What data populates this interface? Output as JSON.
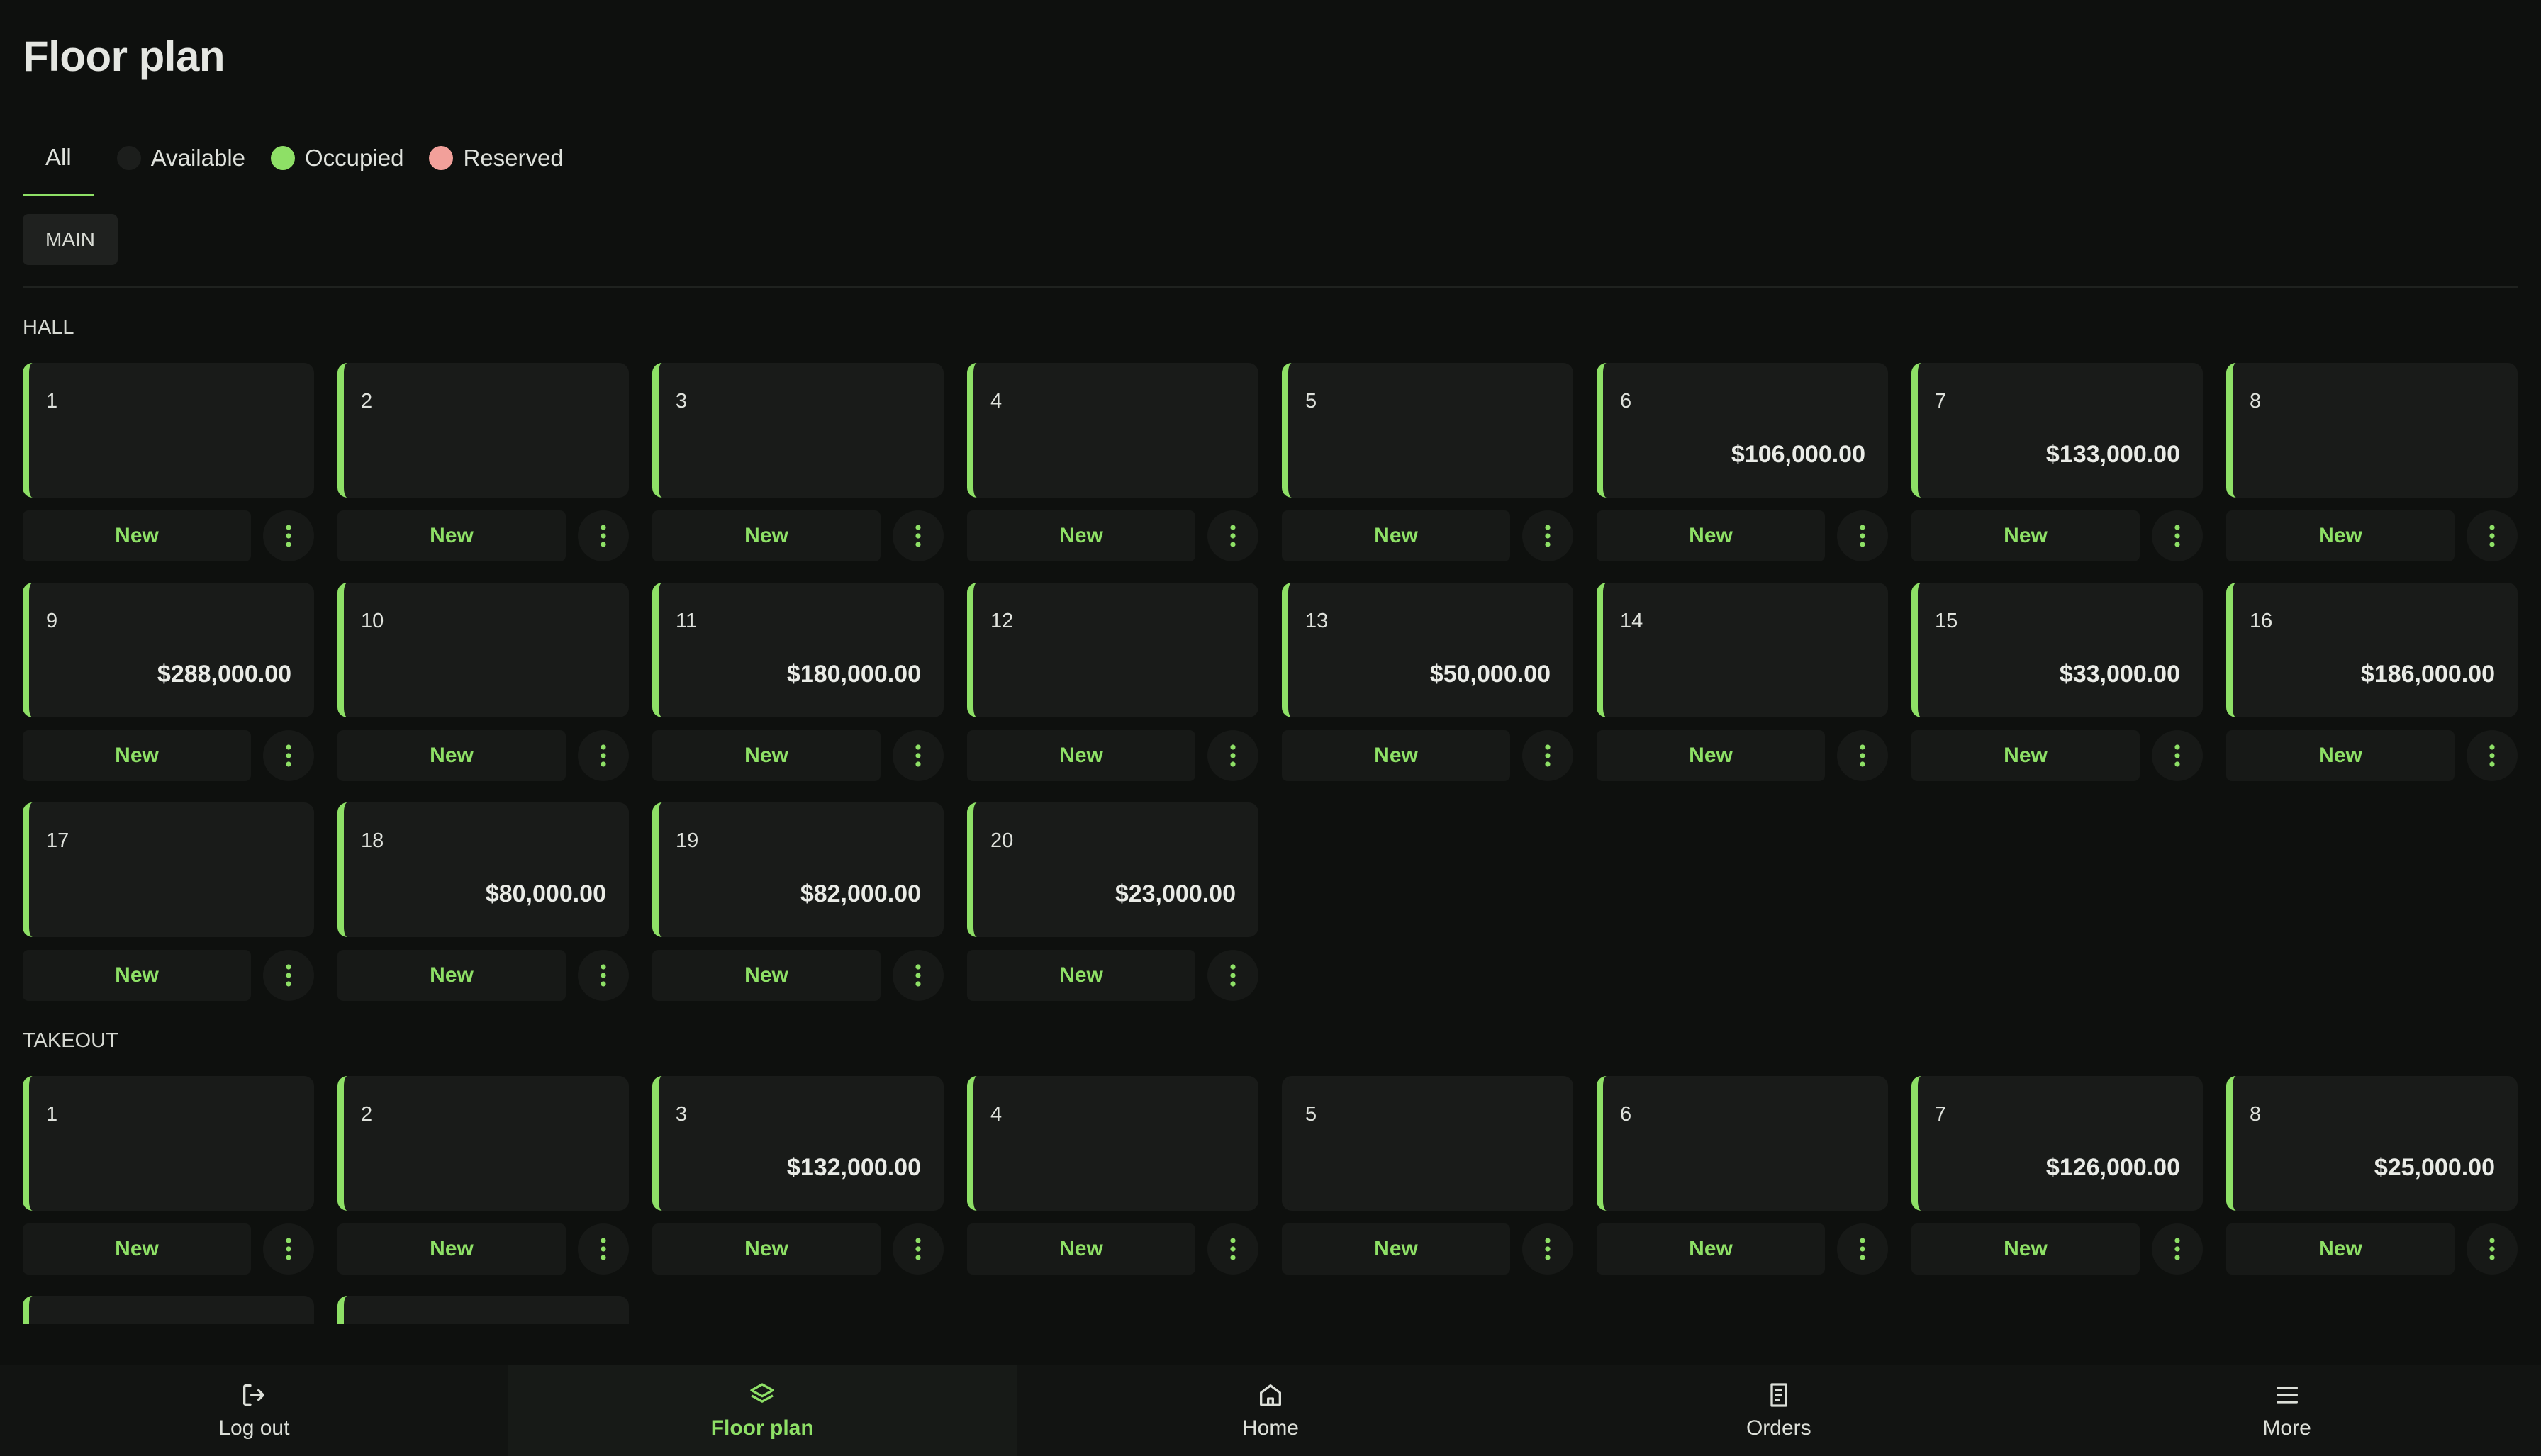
{
  "page": {
    "title": "Floor plan"
  },
  "colors": {
    "accent": "#8ee066",
    "available": "#1c1e1c",
    "occupied": "#8ee066",
    "reserved": "#f2a09a"
  },
  "filters": [
    {
      "label": "All",
      "active": true
    },
    {
      "label": "Available",
      "dot": "available"
    },
    {
      "label": "Occupied",
      "dot": "occupied"
    },
    {
      "label": "Reserved",
      "dot": "reserved"
    }
  ],
  "section": {
    "label": "MAIN"
  },
  "actions": {
    "new_label": "New"
  },
  "groups": [
    {
      "label": "HALL",
      "tables": [
        {
          "number": "1",
          "amount": ""
        },
        {
          "number": "2",
          "amount": ""
        },
        {
          "number": "3",
          "amount": ""
        },
        {
          "number": "4",
          "amount": ""
        },
        {
          "number": "5",
          "amount": ""
        },
        {
          "number": "6",
          "amount": "$106,000.00"
        },
        {
          "number": "7",
          "amount": "$133,000.00"
        },
        {
          "number": "8",
          "amount": ""
        },
        {
          "number": "9",
          "amount": "$288,000.00"
        },
        {
          "number": "10",
          "amount": ""
        },
        {
          "number": "11",
          "amount": "$180,000.00"
        },
        {
          "number": "12",
          "amount": ""
        },
        {
          "number": "13",
          "amount": "$50,000.00"
        },
        {
          "number": "14",
          "amount": ""
        },
        {
          "number": "15",
          "amount": "$33,000.00"
        },
        {
          "number": "16",
          "amount": "$186,000.00"
        },
        {
          "number": "17",
          "amount": ""
        },
        {
          "number": "18",
          "amount": "$80,000.00"
        },
        {
          "number": "19",
          "amount": "$82,000.00"
        },
        {
          "number": "20",
          "amount": "$23,000.00"
        }
      ]
    },
    {
      "label": "TAKEOUT",
      "tables": [
        {
          "number": "1",
          "amount": ""
        },
        {
          "number": "2",
          "amount": ""
        },
        {
          "number": "3",
          "amount": "$132,000.00"
        },
        {
          "number": "4",
          "amount": ""
        },
        {
          "number": "5",
          "amount": "",
          "status": "available"
        },
        {
          "number": "6",
          "amount": ""
        },
        {
          "number": "7",
          "amount": "$126,000.00"
        },
        {
          "number": "8",
          "amount": "$25,000.00"
        }
      ]
    }
  ],
  "bottom_nav": [
    {
      "label": "Log out",
      "icon": "log-out-icon"
    },
    {
      "label": "Floor plan",
      "icon": "layers-icon",
      "active": true
    },
    {
      "label": "Home",
      "icon": "home-icon"
    },
    {
      "label": "Orders",
      "icon": "receipt-icon"
    },
    {
      "label": "More",
      "icon": "menu-icon"
    }
  ]
}
